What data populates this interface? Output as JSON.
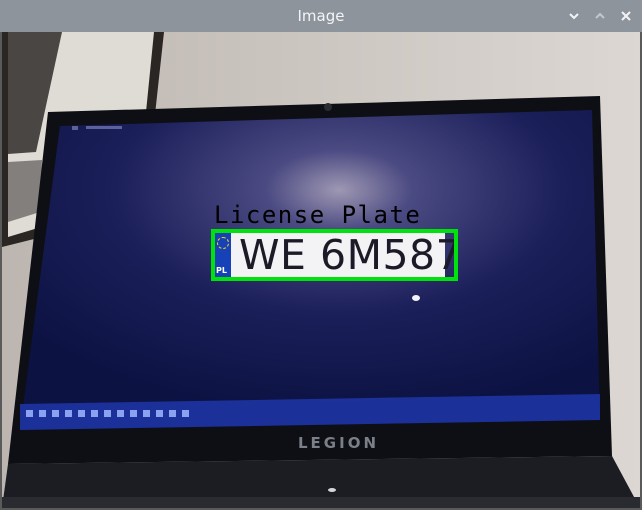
{
  "window": {
    "title": "Image",
    "controls": {
      "minimize_icon": "chevron-down-icon",
      "maximize_icon": "chevron-up-icon",
      "close_icon": "close-icon"
    }
  },
  "detection": {
    "label": "License Plate",
    "plate_text": "WE 6M587",
    "country_code": "PL",
    "box_color": "#00e20c"
  },
  "laptop": {
    "brand": "LEGION"
  }
}
